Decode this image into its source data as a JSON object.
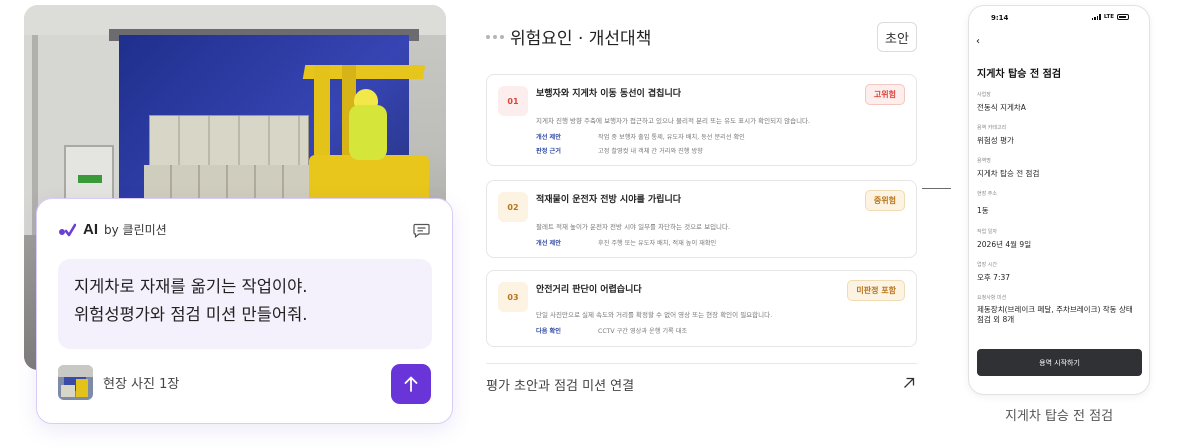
{
  "ai_card": {
    "brand": "AI",
    "by_label": "by 클린미션",
    "prompt_lines": [
      "지게차로 자재를 옮기는 작업이야.",
      "위험성평가와 점검 미션 만들어줘."
    ],
    "attachment_label": "현장 사진 1장"
  },
  "assessment": {
    "section_title": "위험요인 · 개선대책",
    "status_badge": "초안",
    "risks": [
      {
        "num": "01",
        "title": "보행자와 지게차 이동 동선이 겹칩니다",
        "description": "지게차 진행 방향 주축에 보행자가 접근하고 있으나 물리적 분리 또는 유도 표시가 확인되지 않습니다.",
        "level": "고위험",
        "details": [
          {
            "key": "개선 제안",
            "value": "작업 중 보행자 출입 통제, 유도자 배치, 동선 분리선 확인"
          },
          {
            "key": "판정 근거",
            "value": "고정 촬영컷 내 객체 간 거리와 진행 방향"
          }
        ]
      },
      {
        "num": "02",
        "title": "적재물이 운전자 전방 시야를 가립니다",
        "description": "팔레트 적재 높이가 운전자 전방 시야 일부를 차단하는 것으로 보입니다.",
        "level": "중위험",
        "details": [
          {
            "key": "개선 제안",
            "value": "후진 주행 또는 유도자 배치, 적재 높이 재확인"
          }
        ]
      },
      {
        "num": "03",
        "title": "안전거리 판단이 어렵습니다",
        "description": "단일 사진만으로 실제 속도와 거리를 확정할 수 없어 영상 또는 현장 확인이 필요합니다.",
        "level": "미판정 포함",
        "details": [
          {
            "key": "다음 확인",
            "value": "CCTV 구간 영상과 운행 기록 대조"
          }
        ]
      }
    ],
    "link_label": "평가 초안과 점검 미션 연결"
  },
  "phone": {
    "time": "9:14",
    "network": "LTE",
    "title": "지게차 탑승 전 점검",
    "fields": [
      {
        "label": "사업장",
        "value": "전동식 지게차A"
      },
      {
        "label": "용역 카테고리",
        "value": "위험성 평가"
      },
      {
        "label": "용역명",
        "value": "지게차 탑승 전 점검"
      },
      {
        "label": "현장 주소",
        "value": "1동"
      },
      {
        "label": "작업 일자",
        "value": "2026년 4월 9일"
      },
      {
        "label": "업장 시간",
        "value": "오후 7:37"
      },
      {
        "label": "요청사항 미션",
        "value": "제동장치(브레이크 페달, 주차브레이크) 작동 상태 점검 외 8개"
      }
    ],
    "start_button": "용역 시작하기",
    "caption": "지게차 탑승 전 점검"
  },
  "colors": {
    "accent": "#6a35d8",
    "high_risk": "#d9453b",
    "mid_risk": "#b9741a",
    "undetermined": "#b9741a"
  },
  "icons": [
    "ai-logo-icon",
    "chat-icon",
    "arrow-up-icon",
    "arrow-up-right-icon",
    "back-chevron-icon"
  ]
}
